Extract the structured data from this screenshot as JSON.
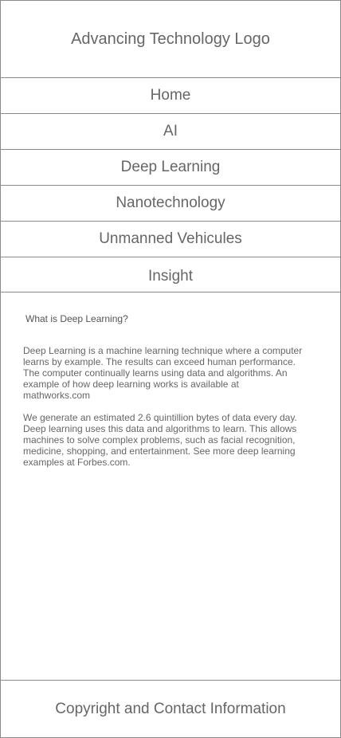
{
  "header": {
    "logo_text": "Advancing Technology Logo"
  },
  "nav": {
    "items": [
      {
        "label": "Home"
      },
      {
        "label": "AI"
      },
      {
        "label": "Deep Learning"
      },
      {
        "label": "Nanotechnology"
      },
      {
        "label": "Unmanned Vehicules"
      },
      {
        "label": "Insight"
      }
    ]
  },
  "main": {
    "title": "What is Deep Learning?",
    "paragraphs": [
      "Deep Learning is a machine learning technique where a computer learns by example. The results can exceed human performance. The computer continually learns using data and algorithms. An example of how deep learning works is available at mathworks.com",
      "We generate an estimated 2.6 quintillion bytes of data every day. Deep learning uses this data and algorithms to learn. This allows machines to solve complex problems, such as facial recognition, medicine, shopping, and entertainment. See more deep learning examples at Forbes.com."
    ]
  },
  "footer": {
    "text": "Copyright and Contact Information"
  }
}
